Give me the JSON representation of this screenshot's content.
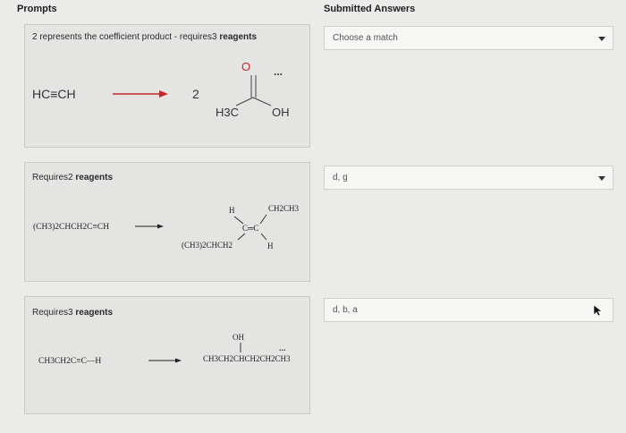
{
  "headers": {
    "prompts": "Prompts",
    "answers": "Submitted Answers"
  },
  "prompts": [
    {
      "title_plain": "2 represents the coefficient product - requires3 ",
      "title_bold": "reagents",
      "reactant": "HC≡CH",
      "coefficient": "2",
      "product_methyl": "H3C",
      "product_oh": "OH",
      "product_o": "O",
      "dots": "..."
    },
    {
      "title_plain": "Requires2 ",
      "title_bold": "reagents",
      "reactant": "(CH3)2CHCH2C≡CH",
      "product_h_top": "H",
      "product_r_top": "CH2CH3",
      "product_cc": "C═C",
      "product_r_bottom": "(CH3)2CHCH2",
      "product_h_bottom": "H"
    },
    {
      "title_plain": "Requires3 ",
      "title_bold": "reagents",
      "reactant": "CH3CH2C≡C—H",
      "product_oh": "OH",
      "product_chain": "CH3CH2CHCH2CH2CH3",
      "dots": "..."
    }
  ],
  "answers": [
    {
      "value": "Choose a match",
      "icon": "chevron-down-icon"
    },
    {
      "value": "d, g",
      "icon": "chevron-down-icon"
    },
    {
      "value": "d, b, a",
      "icon": "cursor-icon"
    }
  ]
}
